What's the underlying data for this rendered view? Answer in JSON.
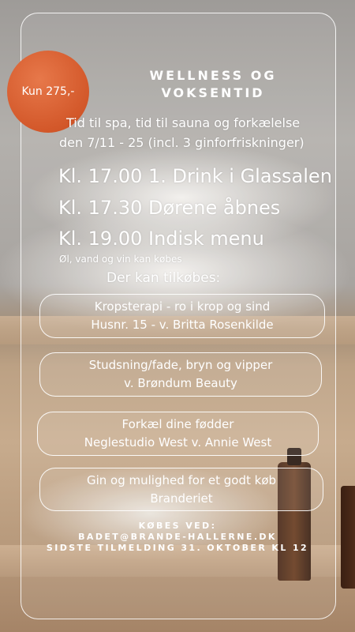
{
  "price_badge": "Kun 275,-",
  "title_line1": "WELLNESS OG",
  "title_line2": "VOKSENTID",
  "intro_line1": "Tid til spa, tid til sauna og forkælelse",
  "intro_line2": "den 7/11 - 25 (incl. 3 ginforfriskninger)",
  "schedule": [
    "Kl. 17.00 1. Drink i Glassalen",
    "Kl. 17.30 Dørene åbnes",
    "Kl. 19.00 Indisk menu"
  ],
  "drinks_note": "Øl, vand og vin kan købes",
  "extras_heading": "Der kan tilkøbes:",
  "extras": [
    {
      "line1": "Kropsterapi - ro i krop og sind",
      "line2": "Husnr. 15 - v. Britta Rosenkilde"
    },
    {
      "line1": "Studsning/fade, bryn og vipper",
      "line2": "v. Brøndum Beauty"
    },
    {
      "line1": "Forkæl dine fødder",
      "line2": "Neglestudio West v. Annie West"
    },
    {
      "line1": "Gin og mulighed for et godt køb",
      "line2": "Branderiet"
    }
  ],
  "footer": {
    "line1": "KØBES VED:",
    "line2": "BADET@BRANDE-HALLERNE.DK",
    "line3": "SIDSTE TILMELDING 31. OKTOBER KL 12"
  },
  "colors": {
    "badge": "#d3582a",
    "text": "#ffffff"
  }
}
